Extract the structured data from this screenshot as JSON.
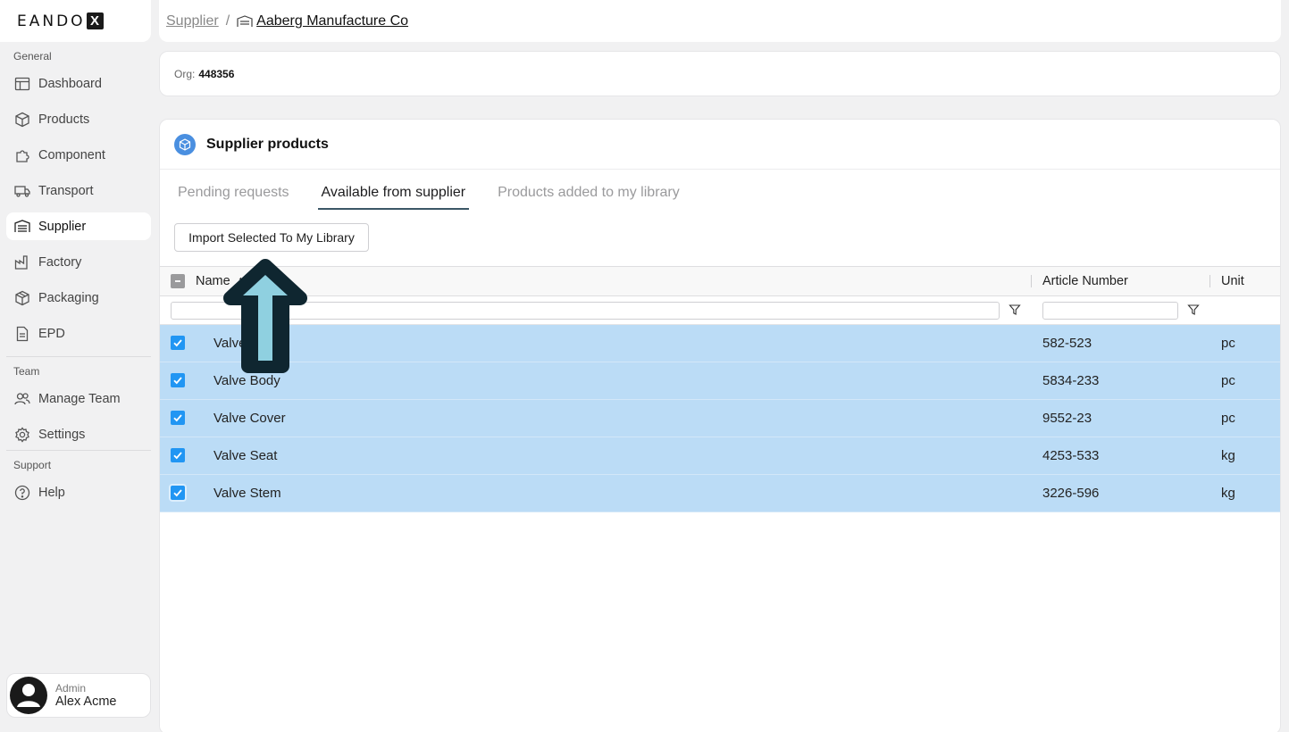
{
  "app": {
    "logo_text": "EANDO",
    "logo_mark": "X"
  },
  "sidebar": {
    "sections": {
      "general": "General",
      "team": "Team",
      "support": "Support"
    },
    "items": [
      {
        "label": "Dashboard",
        "icon": "dashboard-icon"
      },
      {
        "label": "Products",
        "icon": "cube-icon"
      },
      {
        "label": "Component",
        "icon": "puzzle-icon"
      },
      {
        "label": "Transport",
        "icon": "truck-icon"
      },
      {
        "label": "Supplier",
        "icon": "warehouse-icon",
        "active": true
      },
      {
        "label": "Factory",
        "icon": "factory-icon"
      },
      {
        "label": "Packaging",
        "icon": "package-icon"
      },
      {
        "label": "EPD",
        "icon": "document-icon"
      },
      {
        "label": "Manage Team",
        "icon": "users-icon"
      },
      {
        "label": "Settings",
        "icon": "gear-icon"
      },
      {
        "label": "Help",
        "icon": "help-icon"
      }
    ],
    "user": {
      "role": "Admin",
      "name": "Alex Acme"
    }
  },
  "breadcrumb": {
    "parent": "Supplier",
    "separator": "/",
    "current": "Aaberg Manufacture Co"
  },
  "org": {
    "label": "Org:",
    "value": "448356"
  },
  "panel": {
    "title": "Supplier products",
    "tabs": [
      {
        "label": "Pending requests",
        "active": false
      },
      {
        "label": "Available from supplier",
        "active": true
      },
      {
        "label": "Products added to my library",
        "active": false
      }
    ],
    "import_button": "Import Selected To My Library"
  },
  "table": {
    "columns": [
      "Name",
      "Article Number",
      "Unit"
    ],
    "sort_indicator": "↑",
    "rows": [
      {
        "name": "Valve B",
        "article": "582-523",
        "unit": "pc",
        "selected": true
      },
      {
        "name": "Valve Body",
        "article": "5834-233",
        "unit": "pc",
        "selected": true
      },
      {
        "name": "Valve Cover",
        "article": "9552-23",
        "unit": "pc",
        "selected": true
      },
      {
        "name": "Valve Seat",
        "article": "4253-533",
        "unit": "kg",
        "selected": true
      },
      {
        "name": "Valve Stem",
        "article": "3226-596",
        "unit": "kg",
        "selected": true
      }
    ]
  },
  "colors": {
    "selected_row": "#bbdcf6",
    "checkbox": "#2196f3",
    "accent_tab": "#3b5766",
    "overlay_arrow": "#8fd0e0"
  }
}
